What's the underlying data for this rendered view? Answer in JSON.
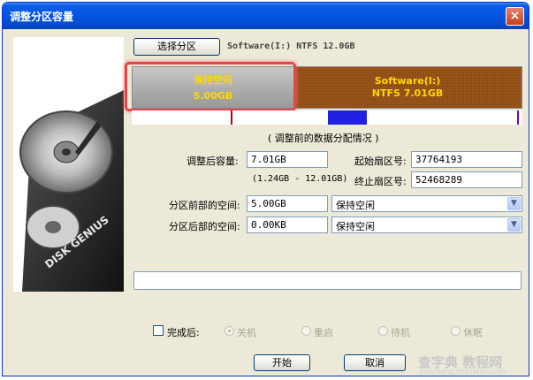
{
  "window": {
    "title": "调整分区容量",
    "close_icon": "×"
  },
  "header": {
    "select_partition_label": "选择分区",
    "drive_info": "Software(I:) NTFS 12.0GB"
  },
  "partition_bar": {
    "free": {
      "name": "保持空闲",
      "size": "5.00GB"
    },
    "partition": {
      "name": "Software(I:)",
      "detail": "NTFS 7.01GB"
    }
  },
  "layout_caption": "( 调整前的数据分配情况 )",
  "form": {
    "size_after_label": "调整后容量:",
    "size_after_value": "7.01GB",
    "size_range": "(1.24GB - 12.01GB)",
    "start_sector_label": "起始扇区号:",
    "start_sector_value": "37764193",
    "end_sector_label": "终止扇区号:",
    "end_sector_value": "52468289",
    "before_space_label": "分区前部的空间:",
    "before_space_value": "5.00GB",
    "before_space_option": "保持空闲",
    "after_space_label": "分区后部的空间:",
    "after_space_value": "0.00KB",
    "after_space_option": "保持空闲"
  },
  "completion": {
    "checkbox_label": "完成后:",
    "options": [
      "关机",
      "重启",
      "待机",
      "休眠"
    ]
  },
  "buttons": {
    "start": "开始",
    "cancel": "取消"
  },
  "logo_text": "DISK GENIUS",
  "watermark": {
    "main": "查字典 教程网",
    "sub": "jiaocheng.chazidian.com"
  },
  "colors": {
    "title_bar": "#0454e0",
    "highlight": "#e8454a",
    "partition": "#8a4a12",
    "label_yellow": "#ffd800"
  }
}
